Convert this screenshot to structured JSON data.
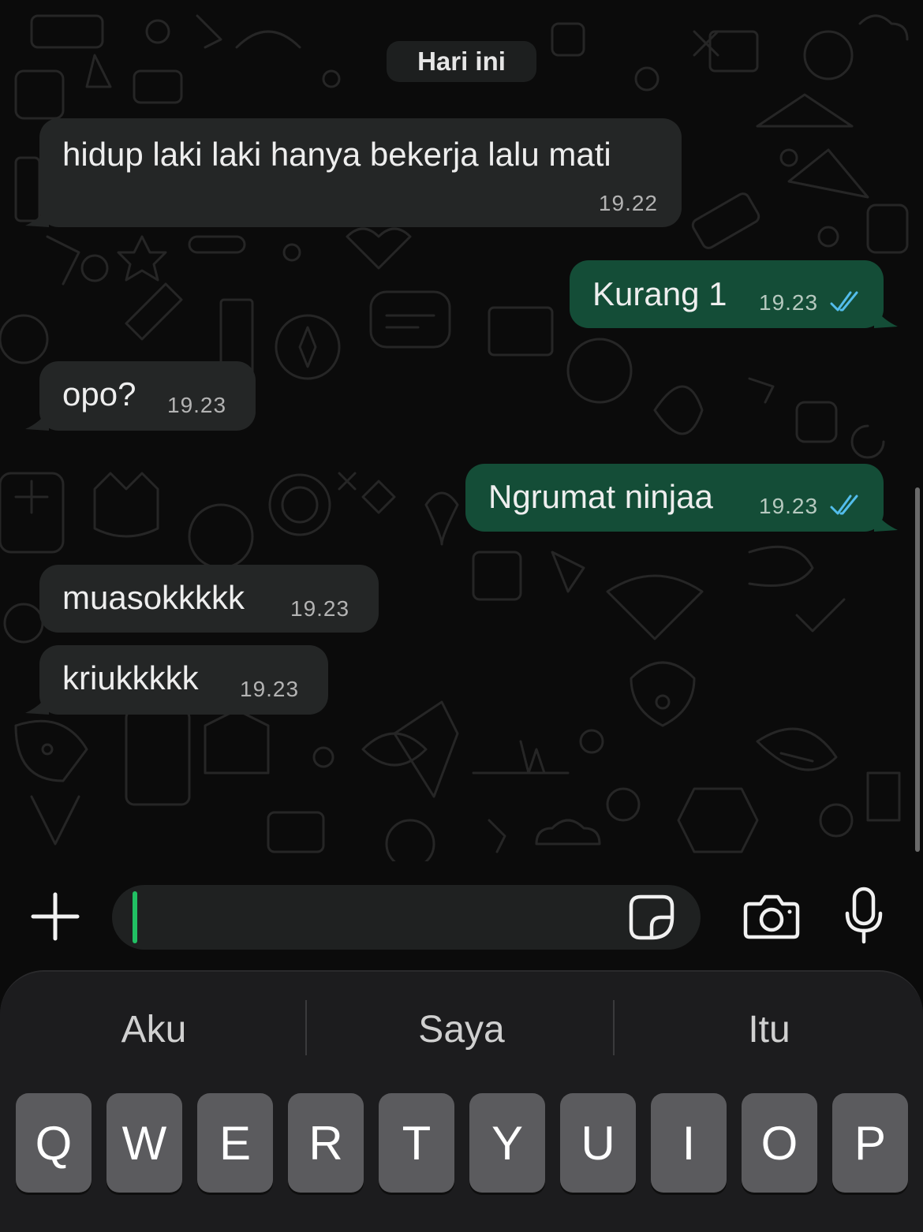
{
  "date_chip": "Hari ini",
  "messages": [
    {
      "direction": "in",
      "text": "hidup laki laki hanya bekerja lalu mati",
      "time": "19.22"
    },
    {
      "direction": "out",
      "text": "Kurang 1",
      "time": "19.23",
      "status": "read"
    },
    {
      "direction": "in",
      "text": "opo?",
      "time": "19.23"
    },
    {
      "direction": "out",
      "text": "Ngrumat ninjaa",
      "time": "19.23",
      "status": "read"
    },
    {
      "direction": "in",
      "text": "muasokkkkk",
      "time": "19.23"
    },
    {
      "direction": "in",
      "text": "kriukkkkk",
      "time": "19.23"
    }
  ],
  "input": {
    "value": "",
    "plus_icon": "plus-icon",
    "sticker_icon": "sticker-icon",
    "camera_icon": "camera-icon",
    "mic_icon": "microphone-icon"
  },
  "keyboard": {
    "suggestions": [
      "Aku",
      "Saya",
      "Itu"
    ],
    "row1": [
      "Q",
      "W",
      "E",
      "R",
      "T",
      "Y",
      "U",
      "I",
      "O",
      "P"
    ]
  },
  "colors": {
    "background": "#0b0b0b",
    "incoming_bubble": "#242626",
    "outgoing_bubble": "#144d37",
    "read_ticks": "#53bdeb",
    "caret": "#21c063"
  }
}
